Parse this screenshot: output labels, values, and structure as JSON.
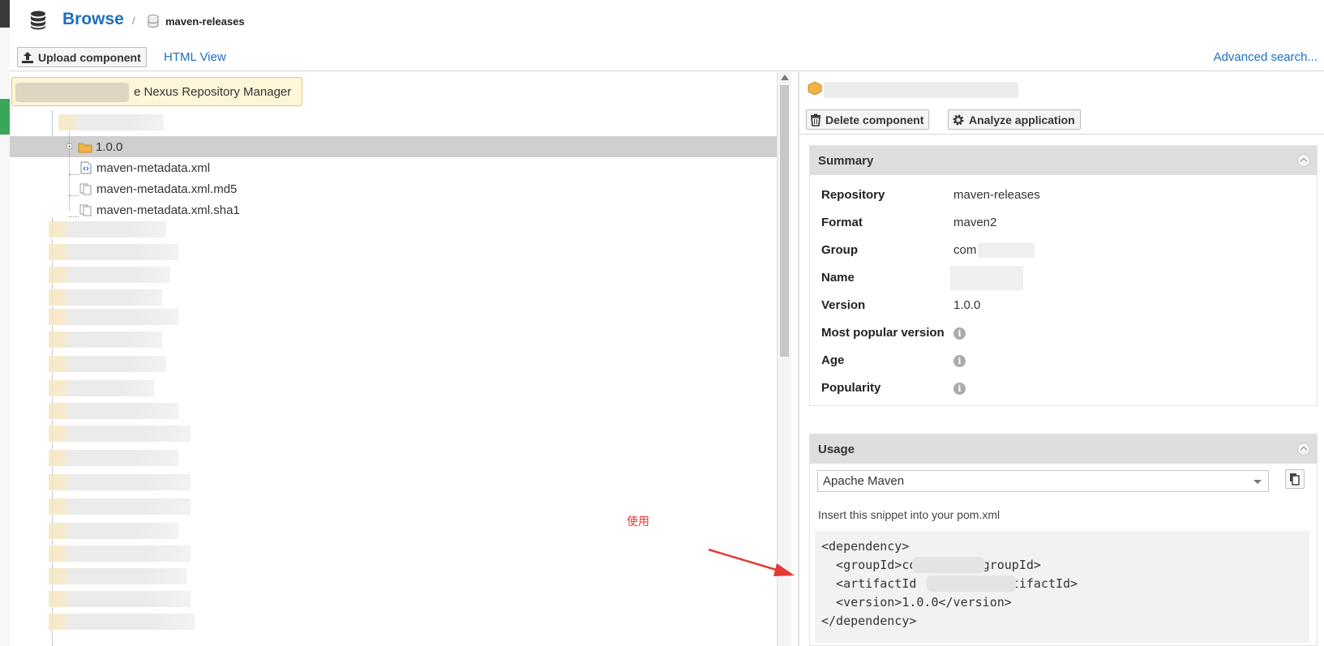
{
  "header": {
    "title": "Browse",
    "separator": "/",
    "breadcrumb": "maven-releases"
  },
  "toolbar": {
    "upload_label": "Upload component",
    "html_view_label": "HTML View",
    "advanced_search_label": "Advanced search..."
  },
  "tree": {
    "tooltip": "e Nexus Repository Manager",
    "items": [
      {
        "label": "1.0.0",
        "icon": "package-folder-icon",
        "selected": true
      },
      {
        "label": "maven-metadata.xml",
        "icon": "xml-file-icon"
      },
      {
        "label": "maven-metadata.xml.md5",
        "icon": "file-copies-icon"
      },
      {
        "label": "maven-metadata.xml.sha1",
        "icon": "file-copies-icon"
      }
    ]
  },
  "detail": {
    "delete_label": "Delete component",
    "analyze_label": "Analyze application",
    "summary": {
      "title": "Summary",
      "rows": [
        {
          "key": "Repository",
          "value": "maven-releases"
        },
        {
          "key": "Format",
          "value": "maven2"
        },
        {
          "key": "Group",
          "value": "com"
        },
        {
          "key": "Name",
          "value": ""
        },
        {
          "key": "Version",
          "value": "1.0.0"
        },
        {
          "key": "Most popular version",
          "value": ""
        },
        {
          "key": "Age",
          "value": ""
        },
        {
          "key": "Popularity",
          "value": ""
        }
      ]
    },
    "usage": {
      "title": "Usage",
      "selected_tool": "Apache Maven",
      "hint": "Insert this snippet into your pom.xml",
      "code_lines": [
        "<dependency>",
        "  <groupId>com      </groupId>",
        "  <artifactId        g</artifactId>",
        "  <version>1.0.0</version>",
        "</dependency>"
      ]
    }
  },
  "annotation": {
    "text": "使用",
    "color": "#e53935"
  }
}
